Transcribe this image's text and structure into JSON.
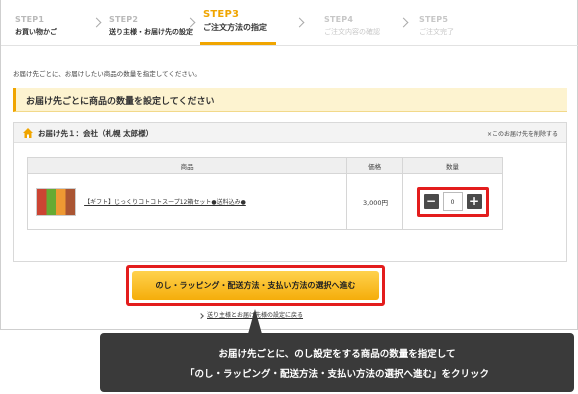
{
  "steps": [
    {
      "num": "STEP1",
      "label": "お買い物かご"
    },
    {
      "num": "STEP2",
      "label": "送り主様・お届け先の設定"
    },
    {
      "num": "STEP3",
      "label": "ご注文方法の指定"
    },
    {
      "num": "STEP4",
      "label": "ご注文内容の確認"
    },
    {
      "num": "STEP5",
      "label": "ご注文完了"
    }
  ],
  "intro": "お届け先ごとに、お届けしたい商品の数量を指定してください。",
  "banner": "お届け先ごとに商品の数量を設定してください",
  "destination": {
    "title": "お届け先１：会社（札幌 太郎様）",
    "delete_link": "×このお届け先を削除する"
  },
  "table": {
    "headers": {
      "product": "商品",
      "price": "価格",
      "qty": "数量"
    },
    "rows": [
      {
        "name": "【ギフト】じっくりコトコトスープ12箱セット●送料込み●",
        "price": "3,000円",
        "qty": "0"
      }
    ]
  },
  "qty_controls": {
    "minus": "−",
    "plus": "+"
  },
  "cta_label": "のし・ラッピング・配送方法・支払い方法の選択へ進む",
  "back_link": "送り主様とお届け先様の設定に戻る",
  "callout": {
    "line1": "お届け先ごとに、のし設定をする商品の数量を指定して",
    "line2": "「のし・ラッピング・配送方法・支払い方法の選択へ進む」をクリック"
  },
  "colors": {
    "accent": "#f0a500",
    "highlight": "#e31d1d",
    "callout_bg": "#3a3a3a"
  }
}
